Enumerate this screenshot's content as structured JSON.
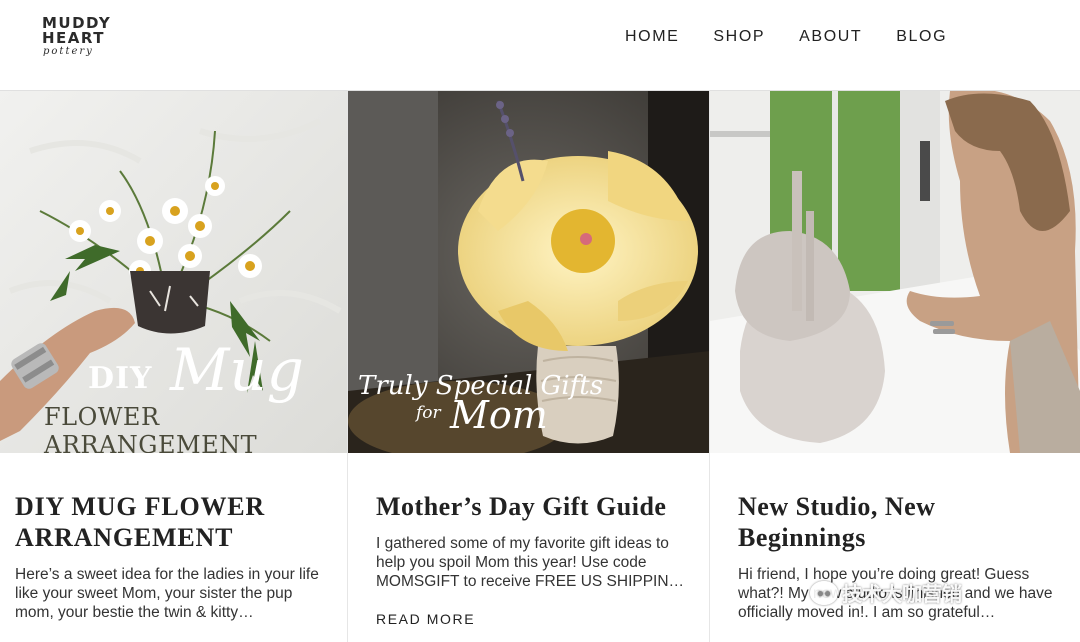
{
  "header": {
    "logo": {
      "line1": "MUDDY",
      "line2": "HEART",
      "line3": "pottery"
    },
    "nav": [
      {
        "label": "HOME"
      },
      {
        "label": "SHOP"
      },
      {
        "label": "ABOUT"
      },
      {
        "label": "BLOG"
      }
    ]
  },
  "posts": [
    {
      "title": "DIY MUG FLOWER ARRANGEMENT",
      "excerpt": "  Here’s a sweet idea for the ladies in your life like your sweet Mom, your sister the pup mom, your bestie the twin & kitty…",
      "image_overlay": {
        "diy": "DIY",
        "mug": "Mug",
        "subtitle": "FLOWER ARRANGEMENT"
      }
    },
    {
      "title": "Mother’s Day Gift Guide",
      "excerpt": "I gathered some of my favorite gift ideas to help you spoil Mom this year! Use code MOMSGIFT to receive FREE US SHIPPIN…",
      "read_more": "READ MORE",
      "image_overlay": {
        "line1": "Truly Special Gifts",
        "for": "for",
        "mom": "Mom"
      }
    },
    {
      "title": "New Studio, New Beginnings",
      "excerpt": "Hi friend, I hope you’re doing great! Guess what?! My new studio is finished and we have officially moved in!. I am so grateful…"
    }
  ],
  "watermark": {
    "text": "技术大咖营销"
  },
  "colors": {
    "accent": "#222222",
    "background": "#ffffff",
    "divider": "#e6e6e6"
  }
}
